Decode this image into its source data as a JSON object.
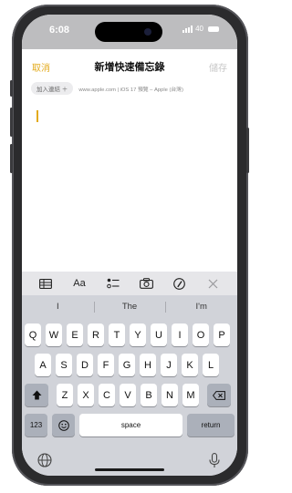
{
  "status": {
    "time": "6:08",
    "battery": "40"
  },
  "header": {
    "cancel": "取消",
    "title": "新增快速備忘錄",
    "save": "儲存"
  },
  "link": {
    "chip": "加入連結 ＋",
    "text": "www.apple.com | iOS 17 預覽 – Apple (台灣)"
  },
  "toolbar": {
    "format_label": "Aa"
  },
  "predictions": [
    "I",
    "The",
    "I'm"
  ],
  "keyboard": {
    "row1": [
      "Q",
      "W",
      "E",
      "R",
      "T",
      "Y",
      "U",
      "I",
      "O",
      "P"
    ],
    "row2": [
      "A",
      "S",
      "D",
      "F",
      "G",
      "H",
      "J",
      "K",
      "L"
    ],
    "row3": [
      "Z",
      "X",
      "C",
      "V",
      "B",
      "N",
      "M"
    ],
    "numbers": "123",
    "space": "space",
    "return": "return"
  },
  "colors": {
    "accent": "#e3aa1b",
    "status_bg": "#bdbdbf",
    "keyboard_bg": "#d1d3d9"
  },
  "icons": [
    "table-icon",
    "checklist-icon",
    "camera-icon",
    "markup-pen-icon",
    "close-icon",
    "shift-icon",
    "delete-icon",
    "emoji-icon",
    "globe-icon",
    "mic-icon"
  ]
}
